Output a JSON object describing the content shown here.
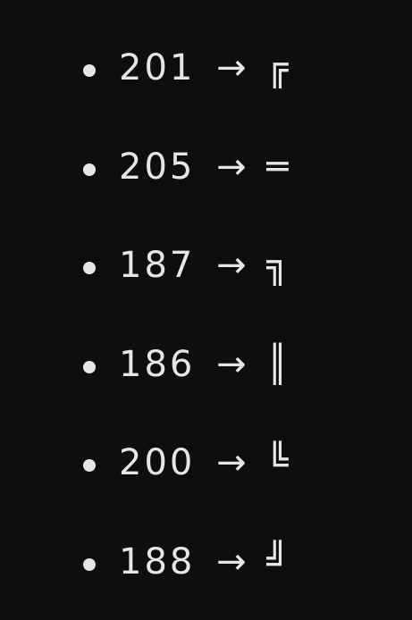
{
  "items": [
    {
      "code": "201",
      "arrow": "→",
      "glyph": "╔"
    },
    {
      "code": "205",
      "arrow": "→",
      "glyph": "═"
    },
    {
      "code": "187",
      "arrow": "→",
      "glyph": "╗"
    },
    {
      "code": "186",
      "arrow": "→",
      "glyph": "║"
    },
    {
      "code": "200",
      "arrow": "→",
      "glyph": "╚"
    },
    {
      "code": "188",
      "arrow": "→",
      "glyph": "╝"
    }
  ]
}
